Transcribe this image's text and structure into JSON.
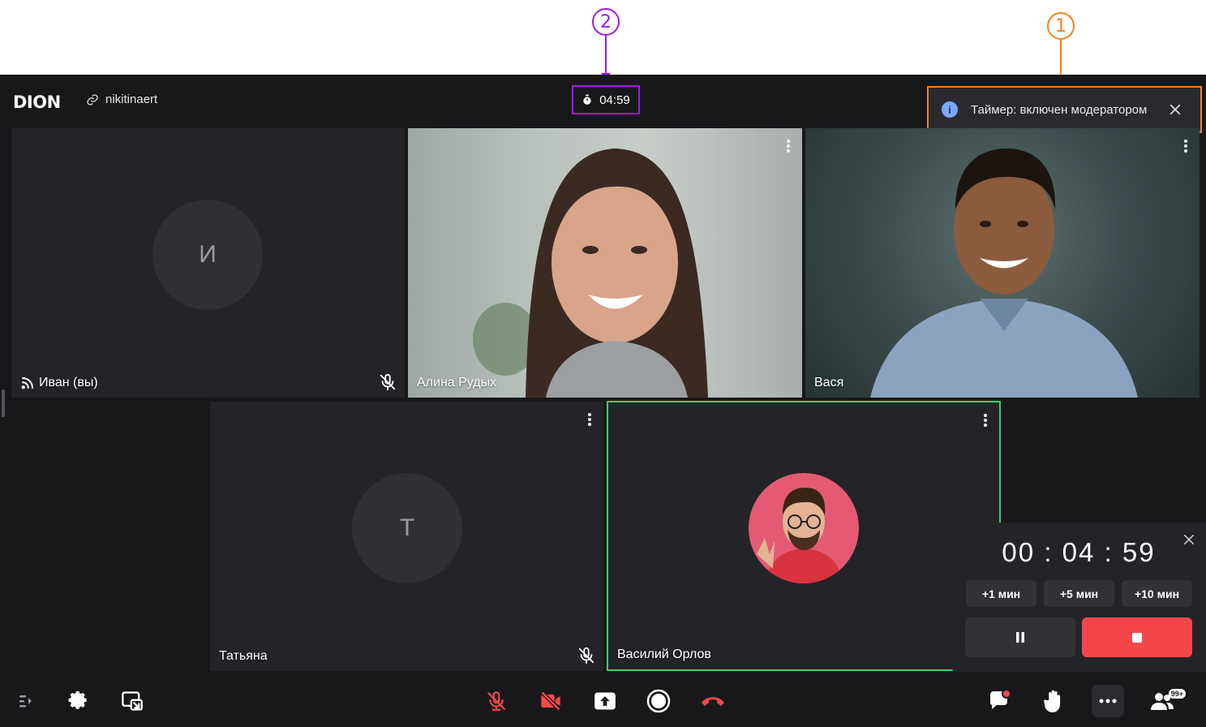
{
  "annotations": [
    {
      "label": "1",
      "color": "#f7821d"
    },
    {
      "label": "2",
      "color": "#9b1bf0"
    }
  ],
  "header": {
    "logo": "DION",
    "room_link": "nikitinaert",
    "timer": "04:59"
  },
  "toast": {
    "message": "Таймер: включен модератором",
    "icon": "info-icon"
  },
  "participants": [
    {
      "name": "Иван (вы)",
      "initial": "И",
      "video": false,
      "muted": true,
      "icon": "broadcast-icon"
    },
    {
      "name": "Алина Рудых",
      "video": true,
      "muted": false
    },
    {
      "name": "Вася",
      "video": true,
      "muted": false
    },
    {
      "name": "Татьяна",
      "initial": "Т",
      "video": false,
      "muted": true
    },
    {
      "name": "Василий Орлов",
      "video": false,
      "speaking": true,
      "muted": false
    }
  ],
  "timer_panel": {
    "time": "00 : 04 : 59",
    "add_buttons": [
      "+1 мин",
      "+5 мин",
      "+10 мин"
    ]
  },
  "toolbar": {
    "badge": "99+"
  },
  "colors": {
    "background": "#18181b",
    "tile": "#242428",
    "speaking_border": "#3ecf6e",
    "danger": "#f5474b",
    "annotation_orange": "#f7821d",
    "annotation_purple": "#9b1bf0"
  }
}
